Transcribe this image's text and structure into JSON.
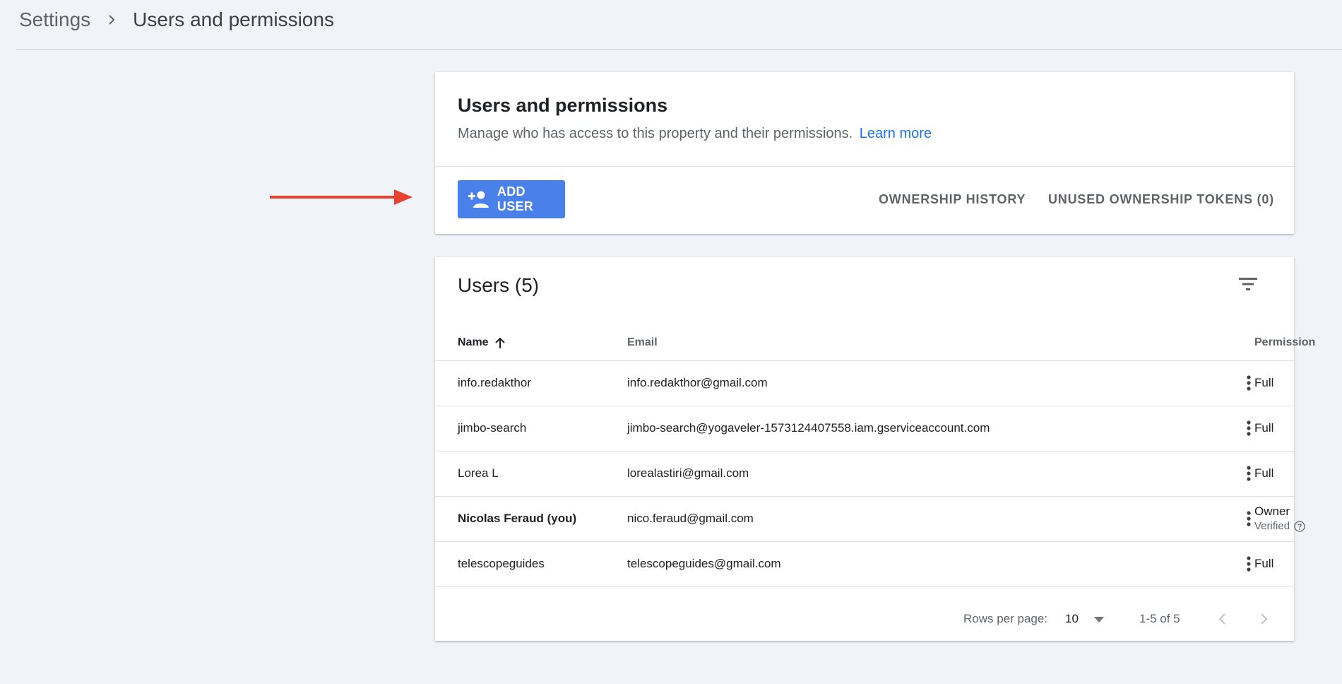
{
  "breadcrumb": {
    "parent": "Settings",
    "current": "Users and permissions"
  },
  "permissions_card": {
    "title": "Users and permissions",
    "description": "Manage who has access to this property and their permissions.",
    "learn_more": "Learn more",
    "add_user_label": "ADD USER",
    "ownership_history_label": "OWNERSHIP HISTORY",
    "unused_tokens_label": "UNUSED OWNERSHIP TOKENS (0)"
  },
  "users_card": {
    "title": "Users (5)",
    "columns": {
      "name": "Name",
      "email": "Email",
      "permission": "Permission"
    },
    "rows": [
      {
        "name": "info.redakthor",
        "email": "info.redakthor@gmail.com",
        "permission": "Full"
      },
      {
        "name": "jimbo-search",
        "email": "jimbo-search@yogaveler-1573124407558.iam.gserviceaccount.com",
        "permission": "Full"
      },
      {
        "name": "Lorea L",
        "email": "lorealastiri@gmail.com",
        "permission": "Full"
      },
      {
        "name": "Nicolas Feraud (you)",
        "email": "nico.feraud@gmail.com",
        "permission": "Owner",
        "permission_sub": "Verified"
      },
      {
        "name": "telescopeguides",
        "email": "telescopeguides@gmail.com",
        "permission": "Full"
      }
    ],
    "pagination": {
      "rows_per_page_label": "Rows per page:",
      "rows_per_page_value": "10",
      "range": "1-5 of 5"
    }
  },
  "colors": {
    "background": "#f0f3f8",
    "primary_button": "#4a80ea",
    "link": "#1a73e8",
    "annotation_arrow": "#e8432e"
  }
}
